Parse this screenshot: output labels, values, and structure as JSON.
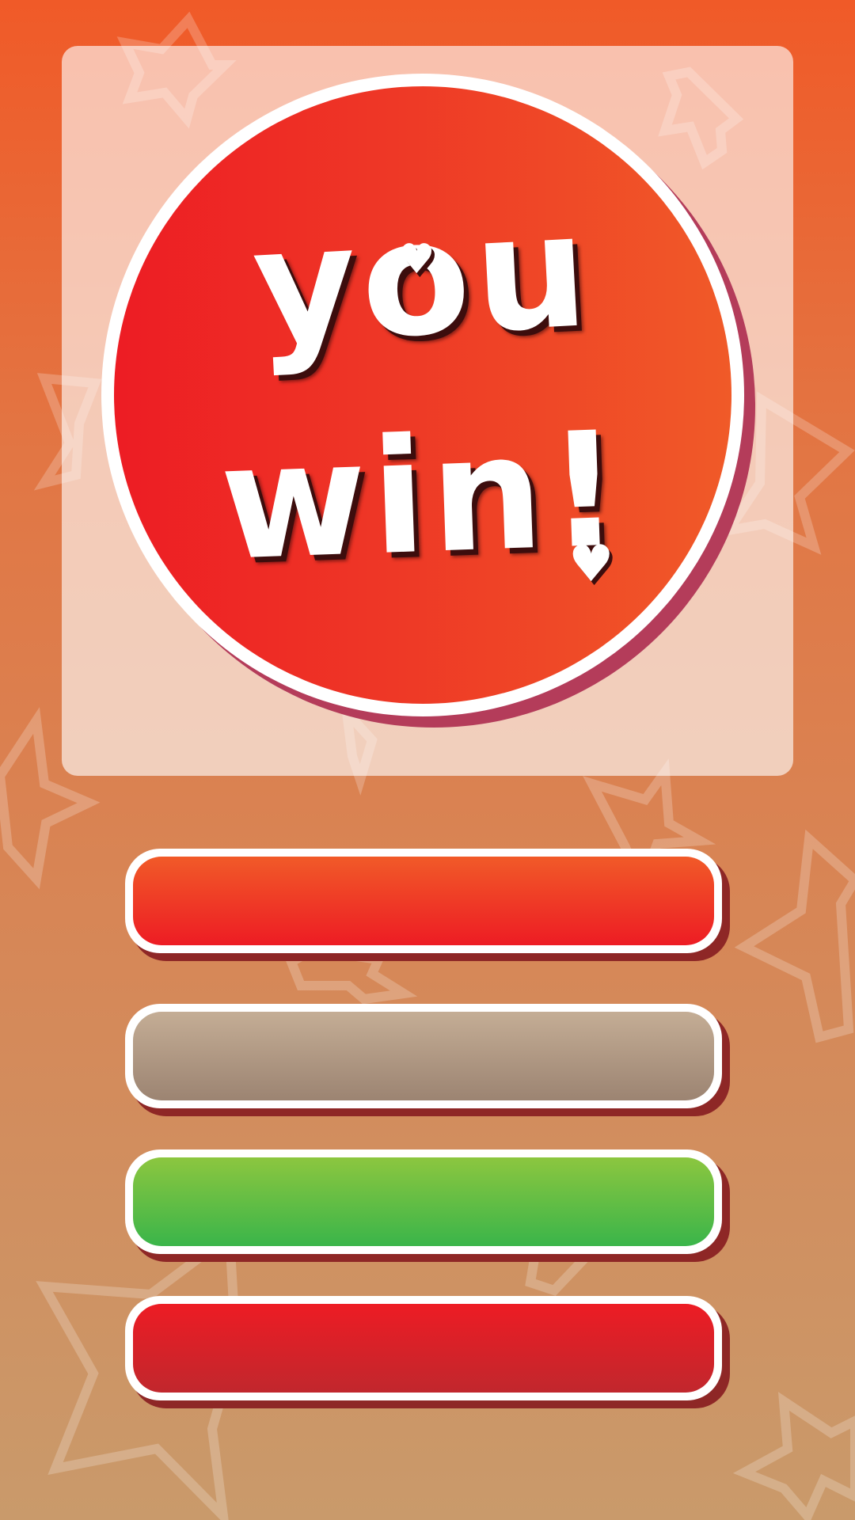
{
  "screen": {
    "background_top": "#F05A28",
    "background_bottom": "#C99A6B",
    "decoration": "outlined-star-icon"
  },
  "win_badge": {
    "line1": "YOU",
    "line2": "WIN!",
    "heart_glyph": "♥",
    "fill_left": "#ED1C24",
    "fill_right": "#F05A28",
    "ring_color": "#FFFFFF",
    "shadow_color": "#B43C5A"
  },
  "buttons": [
    {
      "label": "",
      "color_top": "#F15A28",
      "color_bottom": "#ED1C24"
    },
    {
      "label": "",
      "color_top": "#C4AD95",
      "color_bottom": "#9C8472"
    },
    {
      "label": "",
      "color_top": "#8CC63F",
      "color_bottom": "#3AB54A"
    },
    {
      "label": "",
      "color_top": "#ED1C24",
      "color_bottom": "#C1272D"
    }
  ]
}
